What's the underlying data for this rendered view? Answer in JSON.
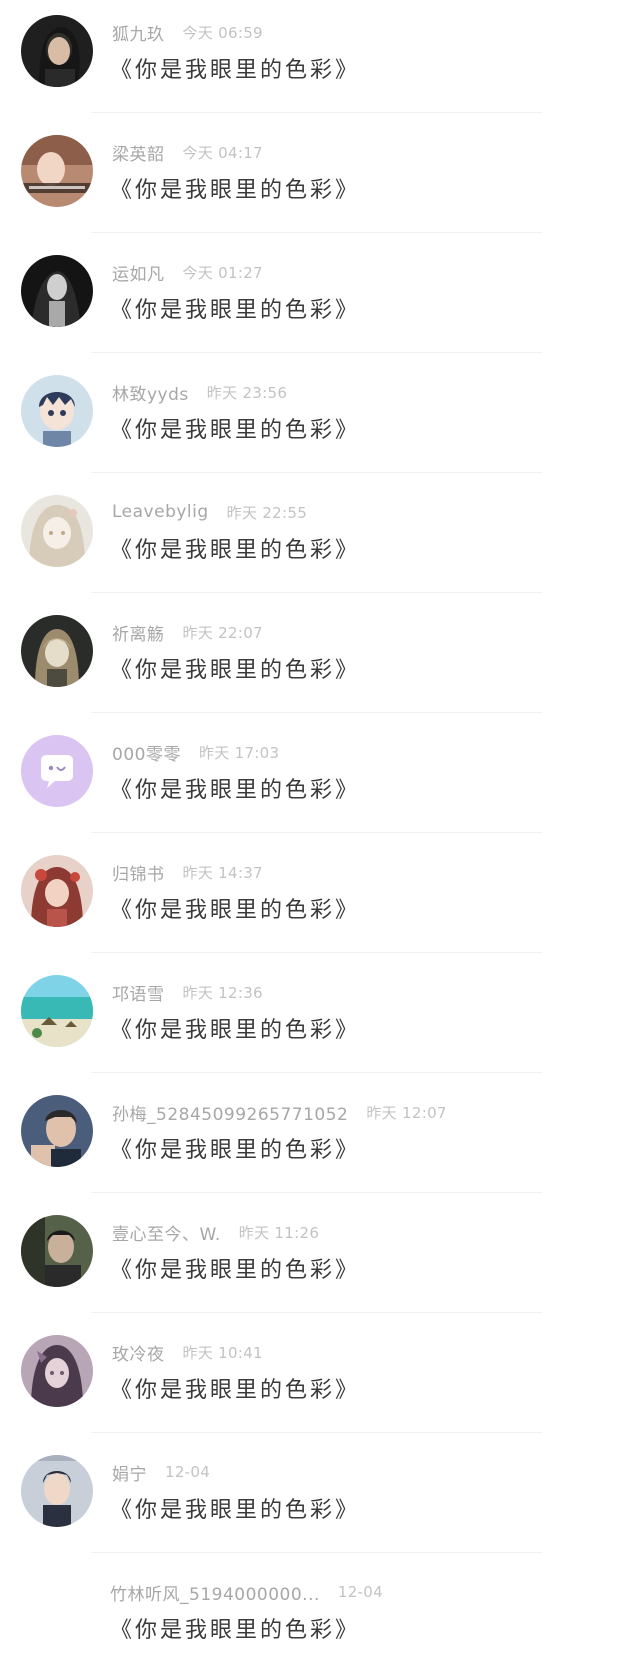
{
  "messages": [
    {
      "name": "狐九玖",
      "time": "今天 06:59",
      "text": "《你是我眼里的色彩》",
      "avatar": "dark-hair-portrait-icon",
      "avatar_bg": "#1f1f1f",
      "avatar_fg": "#d7b8a2"
    },
    {
      "name": "梁英韶",
      "time": "今天 04:17",
      "text": "《你是我眼里的色彩》",
      "avatar": "warm-portrait-icon",
      "avatar_bg": "#b98a72",
      "avatar_fg": "#f1d6c6"
    },
    {
      "name": "运如凡",
      "time": "今天 01:27",
      "text": "《你是我眼里的色彩》",
      "avatar": "monochrome-portrait-icon",
      "avatar_bg": "#141414",
      "avatar_fg": "#cfcfcf"
    },
    {
      "name": "林致yyds",
      "time": "昨天 23:56",
      "text": "《你是我眼里的色彩》",
      "avatar": "anime-boy-icon",
      "avatar_bg": "#cfe0ea",
      "avatar_fg": "#2f3b5a"
    },
    {
      "name": "Leavebylig",
      "time": "昨天 22:55",
      "text": "《你是我眼里的色彩》",
      "avatar": "anime-girl-light-icon",
      "avatar_bg": "#e9e5df",
      "avatar_fg": "#bfa989"
    },
    {
      "name": "祈离觞",
      "time": "昨天 22:07",
      "text": "《你是我眼里的色彩》",
      "avatar": "anime-girl-dark-icon",
      "avatar_bg": "#2a2c2a",
      "avatar_fg": "#c7b79a"
    },
    {
      "name": "000零零",
      "time": "昨天 17:03",
      "text": "《你是我眼里的色彩》",
      "avatar": "chat-bubble-icon",
      "avatar_bg": "#d9c4f2",
      "avatar_fg": "#ffffff"
    },
    {
      "name": "归锦书",
      "time": "昨天 14:37",
      "text": "《你是我眼里的色彩》",
      "avatar": "red-anime-girl-icon",
      "avatar_bg": "#b9544a",
      "avatar_fg": "#f2d3c3"
    },
    {
      "name": "邛语雪",
      "time": "昨天 12:36",
      "text": "《你是我眼里的色彩》",
      "avatar": "beach-scene-icon",
      "avatar_bg": "#39b9b6",
      "avatar_fg": "#e8e2c8"
    },
    {
      "name": "孙梅_52845099265771052",
      "time": "昨天 12:07",
      "text": "《你是我眼里的色彩》",
      "avatar": "man-portrait-icon",
      "avatar_bg": "#4a5d7a",
      "avatar_fg": "#e0c2ac"
    },
    {
      "name": "壹心至今、W.",
      "time": "昨天 11:26",
      "text": "《你是我眼里的色彩》",
      "avatar": "man-dark-portrait-icon",
      "avatar_bg": "#556148",
      "avatar_fg": "#c9b09a"
    },
    {
      "name": "玫冷夜",
      "time": "昨天 10:41",
      "text": "《你是我眼里的色彩》",
      "avatar": "purple-anime-girl-icon",
      "avatar_bg": "#6e5a6e",
      "avatar_fg": "#e5d2d8"
    },
    {
      "name": "娟宁",
      "time": "12-04",
      "text": "《你是我眼里的色彩》",
      "avatar": "young-man-icon",
      "avatar_bg": "#c9cfd8",
      "avatar_fg": "#2b3040"
    },
    {
      "name": "竹林听风_5194000000...",
      "time": "12-04",
      "text": "《你是我眼里的色彩》",
      "avatar": "",
      "avatar_bg": "#ffffff",
      "avatar_fg": "#ffffff"
    }
  ]
}
